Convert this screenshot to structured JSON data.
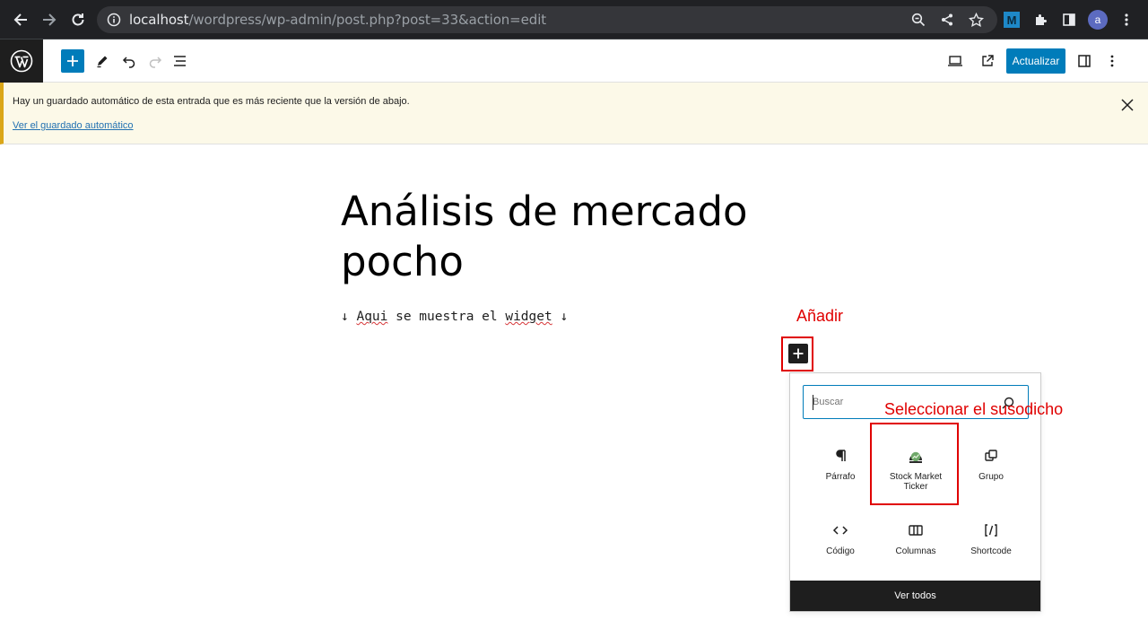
{
  "browser": {
    "url_host": "localhost",
    "url_path": "/wordpress/wp-admin/post.php?post=33&action=edit",
    "profile_initial": "a",
    "extension_label": "M"
  },
  "toolbar": {
    "update_label": "Actualizar"
  },
  "notice": {
    "message": "Hay un guardado automático de esta entrada que es más reciente que la versión de abajo.",
    "link": "Ver el guardado automático"
  },
  "editor": {
    "title_line1": "Análisis de mercado",
    "title_line2": "pocho",
    "para_arrow_left": "↓ ",
    "para_word1": "Aqui",
    "para_middle": " se muestra el ",
    "para_word2": "widget",
    "para_arrow_right": " ↓"
  },
  "annotations": {
    "add": "Añadir",
    "select": "Seleccionar el susodicho"
  },
  "inserter": {
    "search_placeholder": "Buscar",
    "blocks": [
      {
        "label": "Párrafo",
        "icon": "paragraph-icon"
      },
      {
        "label": "Stock Market Ticker",
        "icon": "stock-ticker-icon"
      },
      {
        "label": "Grupo",
        "icon": "group-icon"
      },
      {
        "label": "Código",
        "icon": "code-icon"
      },
      {
        "label": "Columnas",
        "icon": "columns-icon"
      },
      {
        "label": "Shortcode",
        "icon": "shortcode-icon"
      }
    ],
    "see_all": "Ver todos"
  },
  "colors": {
    "wp_blue": "#007cba",
    "annotation_red": "#e00000",
    "notice_bg": "#fcf9e8"
  }
}
